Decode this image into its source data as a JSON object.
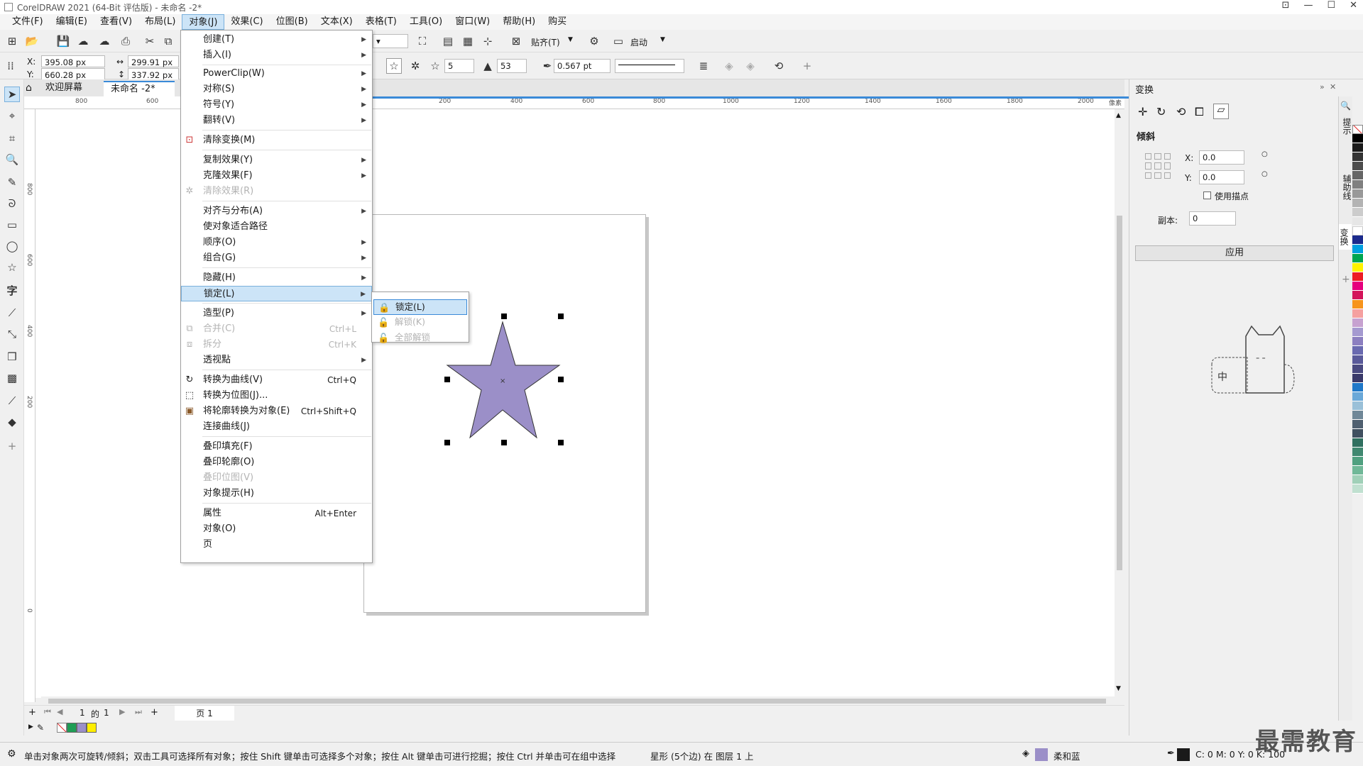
{
  "window": {
    "title": "CorelDRAW 2021 (64-Bit 评估版) - 未命名 -2*"
  },
  "menubar": [
    {
      "label": "文件(F)"
    },
    {
      "label": "编辑(E)"
    },
    {
      "label": "查看(V)"
    },
    {
      "label": "布局(L)"
    },
    {
      "label": "对象(J)"
    },
    {
      "label": "效果(C)"
    },
    {
      "label": "位图(B)"
    },
    {
      "label": "文本(X)"
    },
    {
      "label": "表格(T)"
    },
    {
      "label": "工具(O)"
    },
    {
      "label": "窗口(W)"
    },
    {
      "label": "帮助(H)"
    },
    {
      "label": "购买"
    }
  ],
  "toolbar": {
    "snap_label": "贴齐(T)",
    "launch_label": "启动",
    "pos_x": "395.08 px",
    "pos_y": "660.28 px",
    "width": "299.91 px",
    "height": "337.92 px",
    "x_label": "X:",
    "y_label": "Y:",
    "star_points": "5",
    "star_sharpness": "53",
    "outline_width": "0.567 pt"
  },
  "tabs": [
    {
      "label": "欢迎屏幕"
    },
    {
      "label": "未命名 -2*"
    }
  ],
  "ruler_h": [
    "800",
    "600",
    "200",
    "400",
    "600",
    "800",
    "1000",
    "1200",
    "1400",
    "1600",
    "1800",
    "2000",
    "像素"
  ],
  "ruler_v": [
    "800",
    "600",
    "400",
    "200",
    "0"
  ],
  "object_menu": {
    "items": [
      {
        "label": "创建(T)"
      },
      {
        "label": "插入(I)"
      },
      {
        "label": "PowerClip(W)"
      },
      {
        "label": "对称(S)"
      },
      {
        "label": "符号(Y)"
      },
      {
        "label": "翻转(V)"
      },
      {
        "label": "清除变换(M)"
      },
      {
        "label": "复制效果(Y)"
      },
      {
        "label": "克隆效果(F)"
      },
      {
        "label": "清除效果(R)"
      },
      {
        "label": "对齐与分布(A)"
      },
      {
        "label": "使对象适合路径"
      },
      {
        "label": "顺序(O)"
      },
      {
        "label": "组合(G)"
      },
      {
        "label": "隐藏(H)"
      },
      {
        "label": "锁定(L)"
      },
      {
        "label": "造型(P)"
      },
      {
        "label": "合并(C)",
        "shortcut": "Ctrl+L"
      },
      {
        "label": "拆分",
        "shortcut": "Ctrl+K"
      },
      {
        "label": "透视點"
      },
      {
        "label": "转换为曲线(V)",
        "shortcut": "Ctrl+Q"
      },
      {
        "label": "转换为位图(J)..."
      },
      {
        "label": "将轮廓转换为对象(E)",
        "shortcut": "Ctrl+Shift+Q"
      },
      {
        "label": "连接曲线(J)"
      },
      {
        "label": "叠印填充(F)"
      },
      {
        "label": "叠印轮廓(O)"
      },
      {
        "label": "叠印位图(V)"
      },
      {
        "label": "对象提示(H)"
      },
      {
        "label": "属性",
        "shortcut": "Alt+Enter"
      },
      {
        "label": "对象(O)"
      },
      {
        "label": "页"
      }
    ]
  },
  "lock_submenu": {
    "items": [
      {
        "label": "锁定(L)"
      },
      {
        "label": "解锁(K)"
      },
      {
        "label": "全部解锁"
      }
    ]
  },
  "transform_panel": {
    "title": "变换",
    "section": "倾斜",
    "x_label": "X:",
    "x_value": "0.0",
    "y_label": "Y:",
    "y_value": "0.0",
    "use_anchor": "使用描点",
    "copies_label": "副本:",
    "copies_value": "0",
    "apply": "应用",
    "cat_label": "中"
  },
  "dock_tabs": [
    "提示",
    "辅助线",
    "变换"
  ],
  "page_nav": {
    "current": "1",
    "of": "的",
    "total": "1",
    "page_tab": "页 1"
  },
  "status": {
    "hint": "单击对象两次可旋转/倾斜；双击工具可选择所有对象；按住 Shift 键单击可选择多个对象；按住 Alt 键单击可进行挖掘；按住 Ctrl 并单击可在组中选择",
    "object_info": "星形 (5个边) 在 图层 1 上",
    "fill_name": "柔和蓝",
    "outline_info": "C: 0 M: 0 Y: 0 K: 100"
  },
  "watermark": "最需教育",
  "colors": {
    "accent": "#3a8ad8",
    "star_fill": "#9b8fc8",
    "menu_highlight": "#cce4f7"
  }
}
